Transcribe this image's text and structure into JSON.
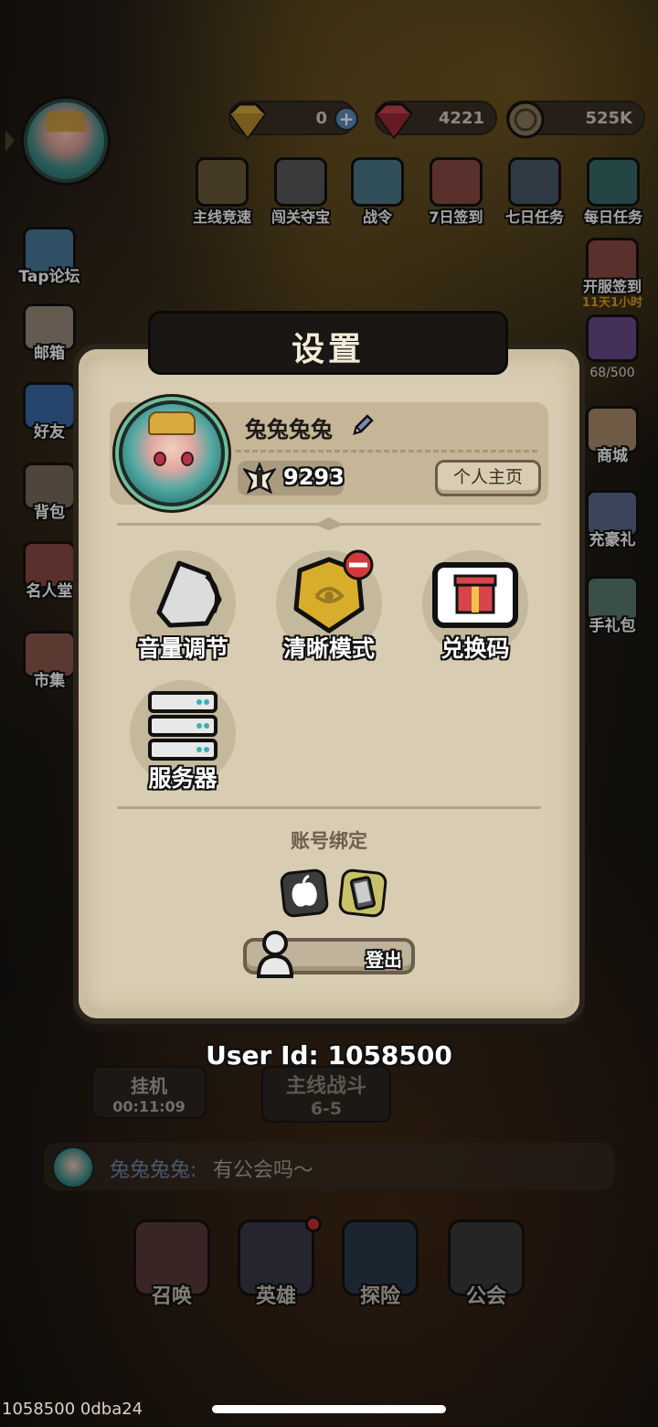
{
  "currencies": [
    {
      "icon": "gold-gem-icon",
      "value": "0"
    },
    {
      "icon": "red-gem-icon",
      "value": "4221"
    },
    {
      "icon": "coin-icon",
      "value": "525K"
    }
  ],
  "activities": [
    {
      "label": "主线竞速",
      "icon": "trophy-icon"
    },
    {
      "label": "闯关夺宝",
      "icon": "dragon-icon"
    },
    {
      "label": "战令",
      "icon": "feather-icon"
    },
    {
      "label": "7日签到",
      "icon": "calendar-icon"
    },
    {
      "label": "七日任务",
      "icon": "helmet-icon"
    },
    {
      "label": "每日任务",
      "icon": "quest-icon"
    }
  ],
  "right_side": [
    {
      "label": "开服签到",
      "sub": "11天1小时"
    },
    {
      "label": "68/500"
    },
    {
      "label": "商城"
    },
    {
      "label": "充豪礼"
    },
    {
      "label": "手礼包"
    }
  ],
  "left_side": [
    {
      "label": "Tap论坛"
    },
    {
      "label": "邮箱"
    },
    {
      "label": "好友"
    },
    {
      "label": "背包"
    },
    {
      "label": "名人堂"
    },
    {
      "label": "市集"
    }
  ],
  "settings_modal": {
    "title": "设置",
    "username": "兔兔兔兔",
    "power": "9293",
    "home_button": "个人主页",
    "options": [
      {
        "label": "音量调节",
        "icon": "volume-shell-icon"
      },
      {
        "label": "清晰模式",
        "icon": "clarity-shield-icon"
      },
      {
        "label": "兑换码",
        "icon": "gift-box-icon"
      },
      {
        "label": "服务器",
        "icon": "server-icon"
      }
    ],
    "account_binding": "账号绑定",
    "logout": "登出"
  },
  "user_id": "User Id: 1058500",
  "idle": {
    "label": "挂机",
    "time": "00:11:09"
  },
  "main_battle": {
    "label": "主线战斗",
    "stage": "6-5"
  },
  "chat": {
    "name": "兔兔兔兔:",
    "message": "有公会吗～"
  },
  "bottom_nav": [
    {
      "label": "召唤",
      "icon": "summon-icon"
    },
    {
      "label": "英雄",
      "icon": "hero-icon"
    },
    {
      "label": "探险",
      "icon": "compass-icon"
    },
    {
      "label": "公会",
      "icon": "guild-icon"
    }
  ],
  "footer": "1058500 0dba24",
  "colors": {
    "modal_bg": "#d8ccb2",
    "title_bar": "#191613",
    "accent_gold": "#d8a93e"
  }
}
